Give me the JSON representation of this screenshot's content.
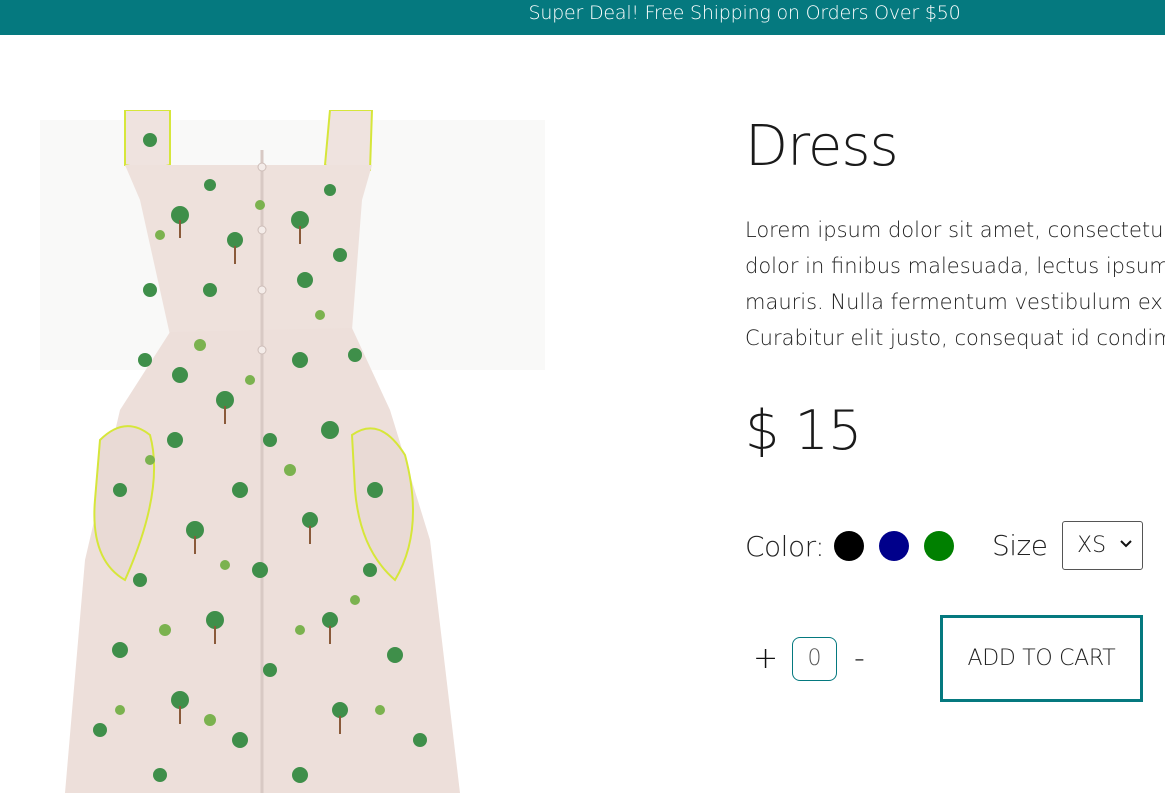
{
  "banner": {
    "text": "Super Deal! Free Shipping on Orders Over $50",
    "color": "#05797f"
  },
  "product": {
    "image_icon": "dress-image",
    "title": "Dress",
    "description_lines": [
      "Lorem ipsum dolor sit amet, consectetur",
      "dolor in finibus malesuada, lectus ipsum p",
      "mauris. Nulla fermentum vestibulum ex, e",
      "Curabitur elit justo, consequat id condime"
    ],
    "price": "$ 15"
  },
  "options": {
    "color_label": "Color:",
    "colors": [
      "#000000",
      "#00008b",
      "#008000"
    ],
    "size_label": "Size",
    "size_selected": "XS"
  },
  "quantity": {
    "plus": "+",
    "value": "0",
    "minus": "-"
  },
  "cart": {
    "button_label": "ADD TO CART"
  }
}
